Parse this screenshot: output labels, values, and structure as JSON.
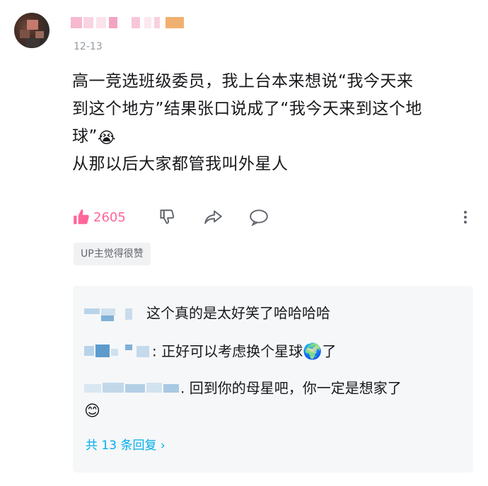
{
  "comment": {
    "date": "12-13",
    "lines": [
      "高一竞选班级委员，我上台本来想说“我今天来",
      "到这个地方”结果张口说成了“我今天来到这个地",
      "球”",
      "从那以后大家都管我叫外星人"
    ],
    "laugh_emoji": "😭",
    "like_count": "2605",
    "up_badge": "UP主觉得很赞"
  },
  "replies": [
    {
      "text": "这个真的是太好笑了哈哈哈哈"
    },
    {
      "text": ": 正好可以考虑换个星球",
      "emoji": "🌍",
      "tail": "了"
    },
    {
      "text": ". 回到你的母星吧，你一定是想家了",
      "emoji": "😊"
    }
  ],
  "more_replies": "共 13 条回复 ›",
  "colors": {
    "accent_pink": "#ff6699",
    "link_blue": "#00aeec",
    "muted": "#9499a0",
    "reply_bg": "#f6f7f8"
  }
}
